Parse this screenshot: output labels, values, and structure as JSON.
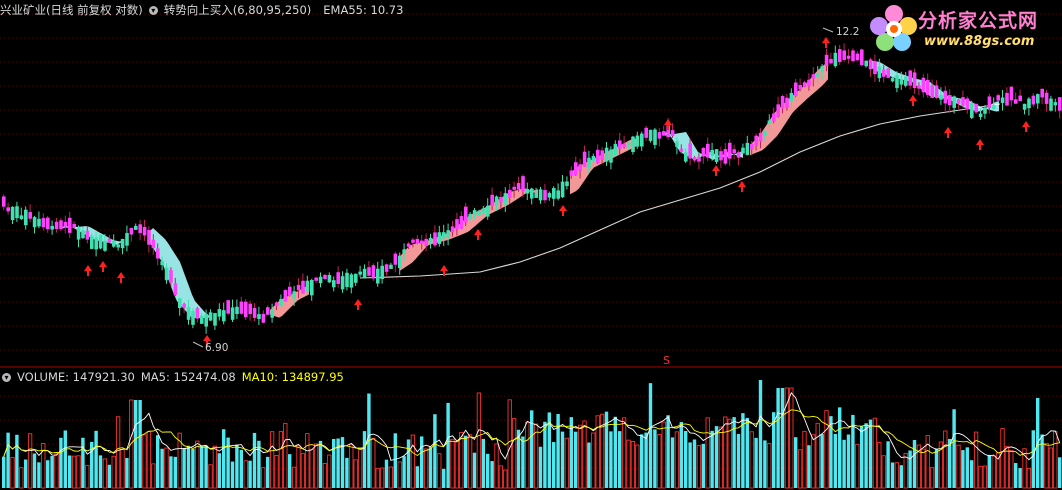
{
  "main_header": {
    "stock_title": "兴业矿业(日线 前复权 对数)",
    "indicator_label": "转势向上买入(6,80,95,250)",
    "ema_label": "EMA55: 10.73"
  },
  "volume_header": {
    "volume_label": "VOLUME: 147921.30",
    "ma5_label": "MA5: 152474.08",
    "ma10_label": "MA10: 134897.95"
  },
  "watermark": {
    "brand": "分析家公式网",
    "url": "www.88gs.com"
  },
  "colors": {
    "up": "#ff40ff",
    "down": "#40e0b0",
    "ribbon_up": "#ffa0a0",
    "ribbon_down": "#a0f0f0",
    "ema_line": "#ffffff",
    "volume_up": "#ff3030",
    "volume_down": "#50e8f0",
    "grid": "#7a0000",
    "arrow": "#ff2020",
    "ma5_line": "#ffffff",
    "ma10_line": "#ffff00"
  },
  "chart_data": {
    "type": "candlestick",
    "scale": "log",
    "annotations": {
      "high_label": "12.2",
      "low_label": "6.90",
      "marker": "S"
    },
    "ema55_end": 10.73,
    "volume_end": 147921.3,
    "ma5_end": 152474.08,
    "ma10_end": 134897.95
  }
}
